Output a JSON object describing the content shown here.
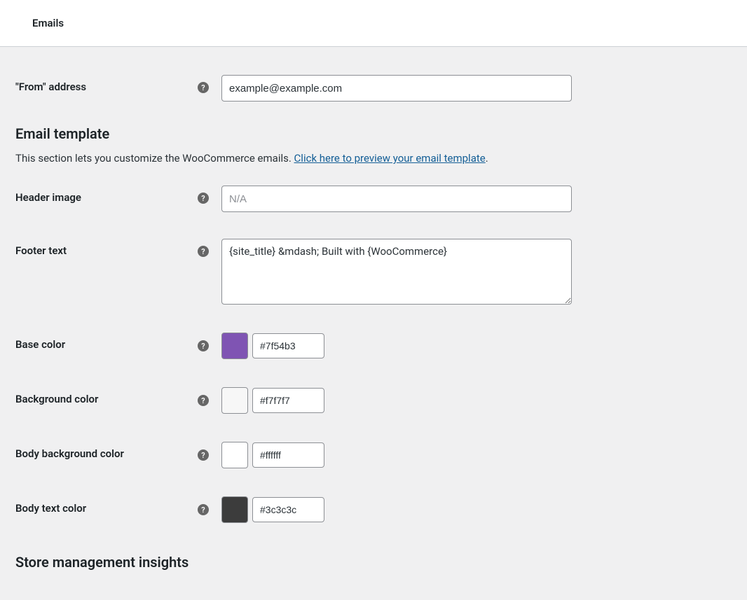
{
  "topTab": {
    "label": "Emails"
  },
  "fromAddress": {
    "label": "\"From\" address",
    "value": "example@example.com"
  },
  "emailTemplate": {
    "heading": "Email template",
    "descriptionPrefix": "This section lets you customize the WooCommerce emails. ",
    "linkText": "Click here to preview your email template",
    "descriptionSuffix": "."
  },
  "headerImage": {
    "label": "Header image",
    "placeholder": "N/A",
    "value": ""
  },
  "footerText": {
    "label": "Footer text",
    "value": "{site_title} &mdash; Built with {WooCommerce}"
  },
  "baseColor": {
    "label": "Base color",
    "hex": "#7f54b3"
  },
  "backgroundColor": {
    "label": "Background color",
    "hex": "#f7f7f7"
  },
  "bodyBackgroundColor": {
    "label": "Body background color",
    "hex": "#ffffff"
  },
  "bodyTextColor": {
    "label": "Body text color",
    "hex": "#3c3c3c"
  },
  "storeInsights": {
    "heading": "Store management insights"
  },
  "helpGlyph": "?"
}
